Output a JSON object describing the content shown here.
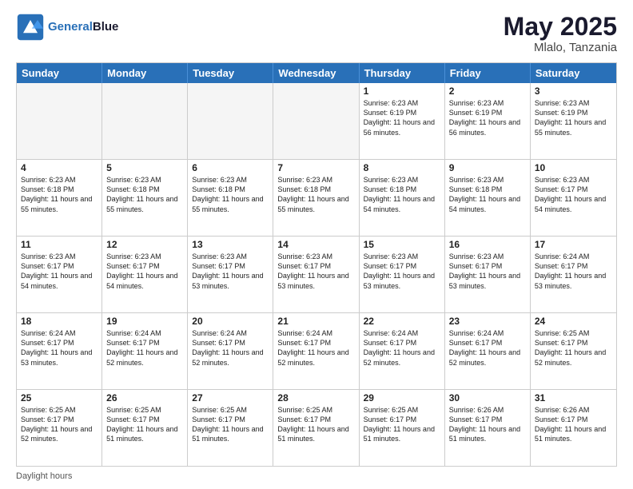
{
  "header": {
    "logo_line1": "General",
    "logo_line2": "Blue",
    "month": "May 2025",
    "location": "Mlalo, Tanzania"
  },
  "days_of_week": [
    "Sunday",
    "Monday",
    "Tuesday",
    "Wednesday",
    "Thursday",
    "Friday",
    "Saturday"
  ],
  "footer": "Daylight hours",
  "weeks": [
    [
      {
        "day": "",
        "info": "",
        "empty": true
      },
      {
        "day": "",
        "info": "",
        "empty": true
      },
      {
        "day": "",
        "info": "",
        "empty": true
      },
      {
        "day": "",
        "info": "",
        "empty": true
      },
      {
        "day": "1",
        "info": "Sunrise: 6:23 AM\nSunset: 6:19 PM\nDaylight: 11 hours\nand 56 minutes.",
        "empty": false
      },
      {
        "day": "2",
        "info": "Sunrise: 6:23 AM\nSunset: 6:19 PM\nDaylight: 11 hours\nand 56 minutes.",
        "empty": false
      },
      {
        "day": "3",
        "info": "Sunrise: 6:23 AM\nSunset: 6:19 PM\nDaylight: 11 hours\nand 55 minutes.",
        "empty": false
      }
    ],
    [
      {
        "day": "4",
        "info": "Sunrise: 6:23 AM\nSunset: 6:18 PM\nDaylight: 11 hours\nand 55 minutes.",
        "empty": false
      },
      {
        "day": "5",
        "info": "Sunrise: 6:23 AM\nSunset: 6:18 PM\nDaylight: 11 hours\nand 55 minutes.",
        "empty": false
      },
      {
        "day": "6",
        "info": "Sunrise: 6:23 AM\nSunset: 6:18 PM\nDaylight: 11 hours\nand 55 minutes.",
        "empty": false
      },
      {
        "day": "7",
        "info": "Sunrise: 6:23 AM\nSunset: 6:18 PM\nDaylight: 11 hours\nand 55 minutes.",
        "empty": false
      },
      {
        "day": "8",
        "info": "Sunrise: 6:23 AM\nSunset: 6:18 PM\nDaylight: 11 hours\nand 54 minutes.",
        "empty": false
      },
      {
        "day": "9",
        "info": "Sunrise: 6:23 AM\nSunset: 6:18 PM\nDaylight: 11 hours\nand 54 minutes.",
        "empty": false
      },
      {
        "day": "10",
        "info": "Sunrise: 6:23 AM\nSunset: 6:17 PM\nDaylight: 11 hours\nand 54 minutes.",
        "empty": false
      }
    ],
    [
      {
        "day": "11",
        "info": "Sunrise: 6:23 AM\nSunset: 6:17 PM\nDaylight: 11 hours\nand 54 minutes.",
        "empty": false
      },
      {
        "day": "12",
        "info": "Sunrise: 6:23 AM\nSunset: 6:17 PM\nDaylight: 11 hours\nand 54 minutes.",
        "empty": false
      },
      {
        "day": "13",
        "info": "Sunrise: 6:23 AM\nSunset: 6:17 PM\nDaylight: 11 hours\nand 53 minutes.",
        "empty": false
      },
      {
        "day": "14",
        "info": "Sunrise: 6:23 AM\nSunset: 6:17 PM\nDaylight: 11 hours\nand 53 minutes.",
        "empty": false
      },
      {
        "day": "15",
        "info": "Sunrise: 6:23 AM\nSunset: 6:17 PM\nDaylight: 11 hours\nand 53 minutes.",
        "empty": false
      },
      {
        "day": "16",
        "info": "Sunrise: 6:23 AM\nSunset: 6:17 PM\nDaylight: 11 hours\nand 53 minutes.",
        "empty": false
      },
      {
        "day": "17",
        "info": "Sunrise: 6:24 AM\nSunset: 6:17 PM\nDaylight: 11 hours\nand 53 minutes.",
        "empty": false
      }
    ],
    [
      {
        "day": "18",
        "info": "Sunrise: 6:24 AM\nSunset: 6:17 PM\nDaylight: 11 hours\nand 53 minutes.",
        "empty": false
      },
      {
        "day": "19",
        "info": "Sunrise: 6:24 AM\nSunset: 6:17 PM\nDaylight: 11 hours\nand 52 minutes.",
        "empty": false
      },
      {
        "day": "20",
        "info": "Sunrise: 6:24 AM\nSunset: 6:17 PM\nDaylight: 11 hours\nand 52 minutes.",
        "empty": false
      },
      {
        "day": "21",
        "info": "Sunrise: 6:24 AM\nSunset: 6:17 PM\nDaylight: 11 hours\nand 52 minutes.",
        "empty": false
      },
      {
        "day": "22",
        "info": "Sunrise: 6:24 AM\nSunset: 6:17 PM\nDaylight: 11 hours\nand 52 minutes.",
        "empty": false
      },
      {
        "day": "23",
        "info": "Sunrise: 6:24 AM\nSunset: 6:17 PM\nDaylight: 11 hours\nand 52 minutes.",
        "empty": false
      },
      {
        "day": "24",
        "info": "Sunrise: 6:25 AM\nSunset: 6:17 PM\nDaylight: 11 hours\nand 52 minutes.",
        "empty": false
      }
    ],
    [
      {
        "day": "25",
        "info": "Sunrise: 6:25 AM\nSunset: 6:17 PM\nDaylight: 11 hours\nand 52 minutes.",
        "empty": false
      },
      {
        "day": "26",
        "info": "Sunrise: 6:25 AM\nSunset: 6:17 PM\nDaylight: 11 hours\nand 51 minutes.",
        "empty": false
      },
      {
        "day": "27",
        "info": "Sunrise: 6:25 AM\nSunset: 6:17 PM\nDaylight: 11 hours\nand 51 minutes.",
        "empty": false
      },
      {
        "day": "28",
        "info": "Sunrise: 6:25 AM\nSunset: 6:17 PM\nDaylight: 11 hours\nand 51 minutes.",
        "empty": false
      },
      {
        "day": "29",
        "info": "Sunrise: 6:25 AM\nSunset: 6:17 PM\nDaylight: 11 hours\nand 51 minutes.",
        "empty": false
      },
      {
        "day": "30",
        "info": "Sunrise: 6:26 AM\nSunset: 6:17 PM\nDaylight: 11 hours\nand 51 minutes.",
        "empty": false
      },
      {
        "day": "31",
        "info": "Sunrise: 6:26 AM\nSunset: 6:17 PM\nDaylight: 11 hours\nand 51 minutes.",
        "empty": false
      }
    ]
  ]
}
